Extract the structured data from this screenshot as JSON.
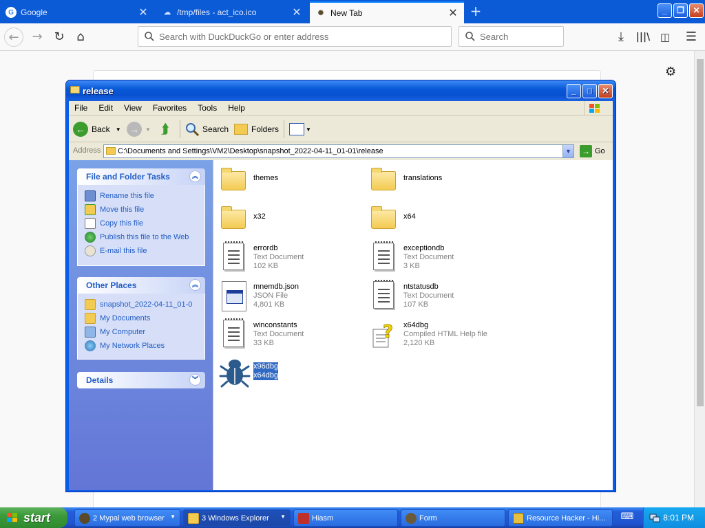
{
  "browser": {
    "tabs": [
      {
        "title": "Google",
        "icon": "google-icon",
        "active": false
      },
      {
        "title": "/tmp/files - act_ico.ico",
        "icon": "upload-cloud-icon",
        "active": false
      },
      {
        "title": "New Tab",
        "icon": "x64dbg-bug-icon",
        "active": true
      }
    ],
    "url_placeholder": "Search with DuckDuckGo or enter address",
    "search_placeholder": "Search",
    "accent": "#0a84ff"
  },
  "explorer": {
    "title": "release",
    "menu": [
      "File",
      "Edit",
      "View",
      "Favorites",
      "Tools",
      "Help"
    ],
    "toolbar": {
      "back": "Back",
      "search": "Search",
      "folders": "Folders"
    },
    "address_label": "Address",
    "address_path": "C:\\Documents and Settings\\VM2\\Desktop\\snapshot_2022-04-11_01-01\\release",
    "go_label": "Go",
    "panels": {
      "tasks": {
        "title": "File and Folder Tasks",
        "items": [
          "Rename this file",
          "Move this file",
          "Copy this file",
          "Publish this file to the Web",
          "E-mail this file"
        ]
      },
      "places": {
        "title": "Other Places",
        "items": [
          "snapshot_2022-04-11_01-0",
          "My Documents",
          "My Computer",
          "My Network Places"
        ]
      },
      "details": {
        "title": "Details"
      }
    },
    "files": [
      {
        "name": "themes",
        "type": "",
        "size": "",
        "icon": "folder-icon"
      },
      {
        "name": "translations",
        "type": "",
        "size": "",
        "icon": "folder-icon"
      },
      {
        "name": "x32",
        "type": "",
        "size": "",
        "icon": "folder-icon"
      },
      {
        "name": "x64",
        "type": "",
        "size": "",
        "icon": "folder-icon"
      },
      {
        "name": "errordb",
        "type": "Text Document",
        "size": "102 KB",
        "icon": "text-document-icon"
      },
      {
        "name": "exceptiondb",
        "type": "Text Document",
        "size": "3 KB",
        "icon": "text-document-icon"
      },
      {
        "name": "mnemdb.json",
        "type": "JSON File",
        "size": "4,801 KB",
        "icon": "json-file-icon"
      },
      {
        "name": "ntstatusdb",
        "type": "Text Document",
        "size": "107 KB",
        "icon": "text-document-icon"
      },
      {
        "name": "winconstants",
        "type": "Text Document",
        "size": "33 KB",
        "icon": "text-document-icon"
      },
      {
        "name": "x64dbg",
        "type": "Compiled HTML Help file",
        "size": "2,120 KB",
        "icon": "chm-help-icon"
      },
      {
        "name": "x96dbg",
        "type": "x64dbg",
        "size": "",
        "icon": "bug-icon",
        "selected": true
      }
    ]
  },
  "taskbar": {
    "start": "start",
    "tasks": [
      {
        "label": "2 Mypal web browser",
        "group": true,
        "active": false
      },
      {
        "label": "3 Windows Explorer",
        "group": true,
        "active": true
      },
      {
        "label": "Hiasm",
        "group": false,
        "active": false
      },
      {
        "label": "Form",
        "group": false,
        "active": false
      },
      {
        "label": "Resource Hacker - Hi...",
        "group": false,
        "active": false
      }
    ],
    "clock": "8:01 PM"
  }
}
